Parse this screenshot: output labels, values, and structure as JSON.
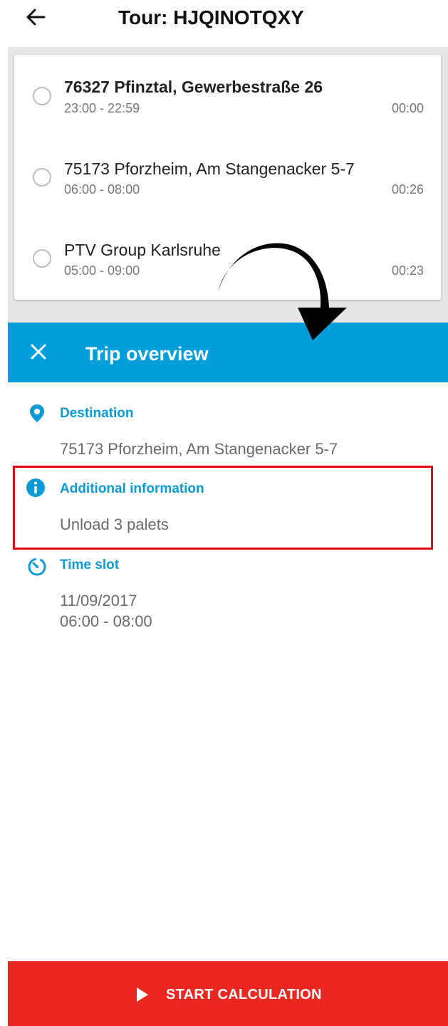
{
  "header": {
    "title": "Tour: HJQINOTQXY"
  },
  "stops": [
    {
      "name": "76327 Pfinztal, Gewerbestraße 26",
      "time": "23:00 - 22:59",
      "duration": "00:00",
      "bold": true
    },
    {
      "name": "75173 Pforzheim, Am Stangenacker 5-7",
      "time": "06:00 - 08:00",
      "duration": "00:26",
      "bold": false
    },
    {
      "name": "PTV Group Karlsruhe",
      "time": "05:00 - 09:00",
      "duration": "00:23",
      "bold": false
    }
  ],
  "panel": {
    "title": "Trip overview",
    "destination": {
      "label": "Destination",
      "value": "75173 Pforzheim, Am Stangenacker 5-7"
    },
    "info": {
      "label": "Additional information",
      "value": "Unload 3 palets"
    },
    "timeslot": {
      "label": "Time slot",
      "date": "11/09/2017",
      "range": "06:00 - 08:00"
    }
  },
  "footer": {
    "button_label": "START CALCULATION"
  },
  "colors": {
    "accent": "#009fda",
    "label": "#0b9bd4",
    "highlight": "#e30613",
    "button": "#ea2820"
  },
  "icons": [
    "back-arrow-icon",
    "close-icon",
    "location-pin-icon",
    "info-icon",
    "timer-icon",
    "play-icon"
  ]
}
